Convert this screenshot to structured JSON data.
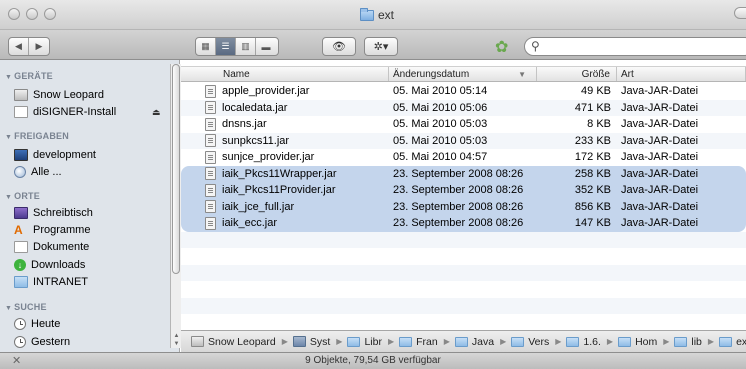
{
  "window": {
    "title": "ext"
  },
  "toolbar": {
    "back_label": "◀",
    "forward_label": "▶",
    "view_icons": "▦",
    "view_list": "☰",
    "view_columns": "▥",
    "view_coverflow": "▬",
    "quicklook_label": "👁",
    "action_label": "✲▾",
    "search_placeholder": ""
  },
  "sidebar": {
    "sections": [
      {
        "title": "GERÄTE",
        "items": [
          "Snow Leopard",
          "diSIGNER-Install"
        ]
      },
      {
        "title": "FREIGABEN",
        "items": [
          "development",
          "Alle ..."
        ]
      },
      {
        "title": "ORTE",
        "items": [
          "Schreibtisch",
          "Programme",
          "Dokumente",
          "Downloads",
          "INTRANET"
        ]
      },
      {
        "title": "SUCHE",
        "items": [
          "Heute",
          "Gestern"
        ]
      }
    ]
  },
  "columns": {
    "name": "Name",
    "date": "Änderungsdatum",
    "size": "Größe",
    "kind": "Art"
  },
  "files": [
    {
      "name": "apple_provider.jar",
      "date": "05. Mai 2010 05:14",
      "size": "49 KB",
      "kind": "Java-JAR-Datei",
      "selected": false
    },
    {
      "name": "localedata.jar",
      "date": "05. Mai 2010 05:06",
      "size": "471 KB",
      "kind": "Java-JAR-Datei",
      "selected": false
    },
    {
      "name": "dnsns.jar",
      "date": "05. Mai 2010 05:03",
      "size": "8 KB",
      "kind": "Java-JAR-Datei",
      "selected": false
    },
    {
      "name": "sunpkcs11.jar",
      "date": "05. Mai 2010 05:03",
      "size": "233 KB",
      "kind": "Java-JAR-Datei",
      "selected": false
    },
    {
      "name": "sunjce_provider.jar",
      "date": "05. Mai 2010 04:57",
      "size": "172 KB",
      "kind": "Java-JAR-Datei",
      "selected": false
    },
    {
      "name": "iaik_Pkcs11Wrapper.jar",
      "date": "23. September 2008 08:26",
      "size": "258 KB",
      "kind": "Java-JAR-Datei",
      "selected": true
    },
    {
      "name": "iaik_Pkcs11Provider.jar",
      "date": "23. September 2008 08:26",
      "size": "352 KB",
      "kind": "Java-JAR-Datei",
      "selected": true
    },
    {
      "name": "iaik_jce_full.jar",
      "date": "23. September 2008 08:26",
      "size": "856 KB",
      "kind": "Java-JAR-Datei",
      "selected": true
    },
    {
      "name": "iaik_ecc.jar",
      "date": "23. September 2008 08:26",
      "size": "147 KB",
      "kind": "Java-JAR-Datei",
      "selected": true
    }
  ],
  "pathbar": [
    "Snow Leopard",
    "Syst",
    "Libr",
    "Fran",
    "Java",
    "Vers",
    "1.6.",
    "Hom",
    "lib",
    "ext"
  ],
  "status": {
    "text": "9 Objekte, 79,54 GB verfügbar"
  }
}
